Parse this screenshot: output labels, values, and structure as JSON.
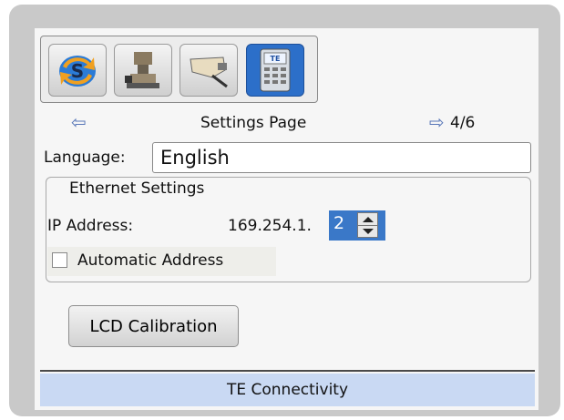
{
  "toolbar": {
    "buttons": [
      {
        "name": "refresh-icon"
      },
      {
        "name": "machine-icon"
      },
      {
        "name": "cable-icon"
      },
      {
        "name": "device-settings-icon",
        "badge": "TE",
        "active": true
      }
    ]
  },
  "nav": {
    "title": "Settings Page",
    "page_indicator": "4/6"
  },
  "language": {
    "label": "Language:",
    "value": "English"
  },
  "ethernet": {
    "legend": "Ethernet Settings",
    "ip_label": "IP Address:",
    "ip_prefix": "169.254.1.",
    "ip_last_octet": "2",
    "auto_label": "Automatic Address",
    "auto_checked": false
  },
  "lcd_button": "LCD Calibration",
  "footer": "TE Connectivity",
  "colors": {
    "accent": "#3a78c8",
    "footer_bg": "#c9d9f3",
    "frame": "#c9c9c9"
  }
}
